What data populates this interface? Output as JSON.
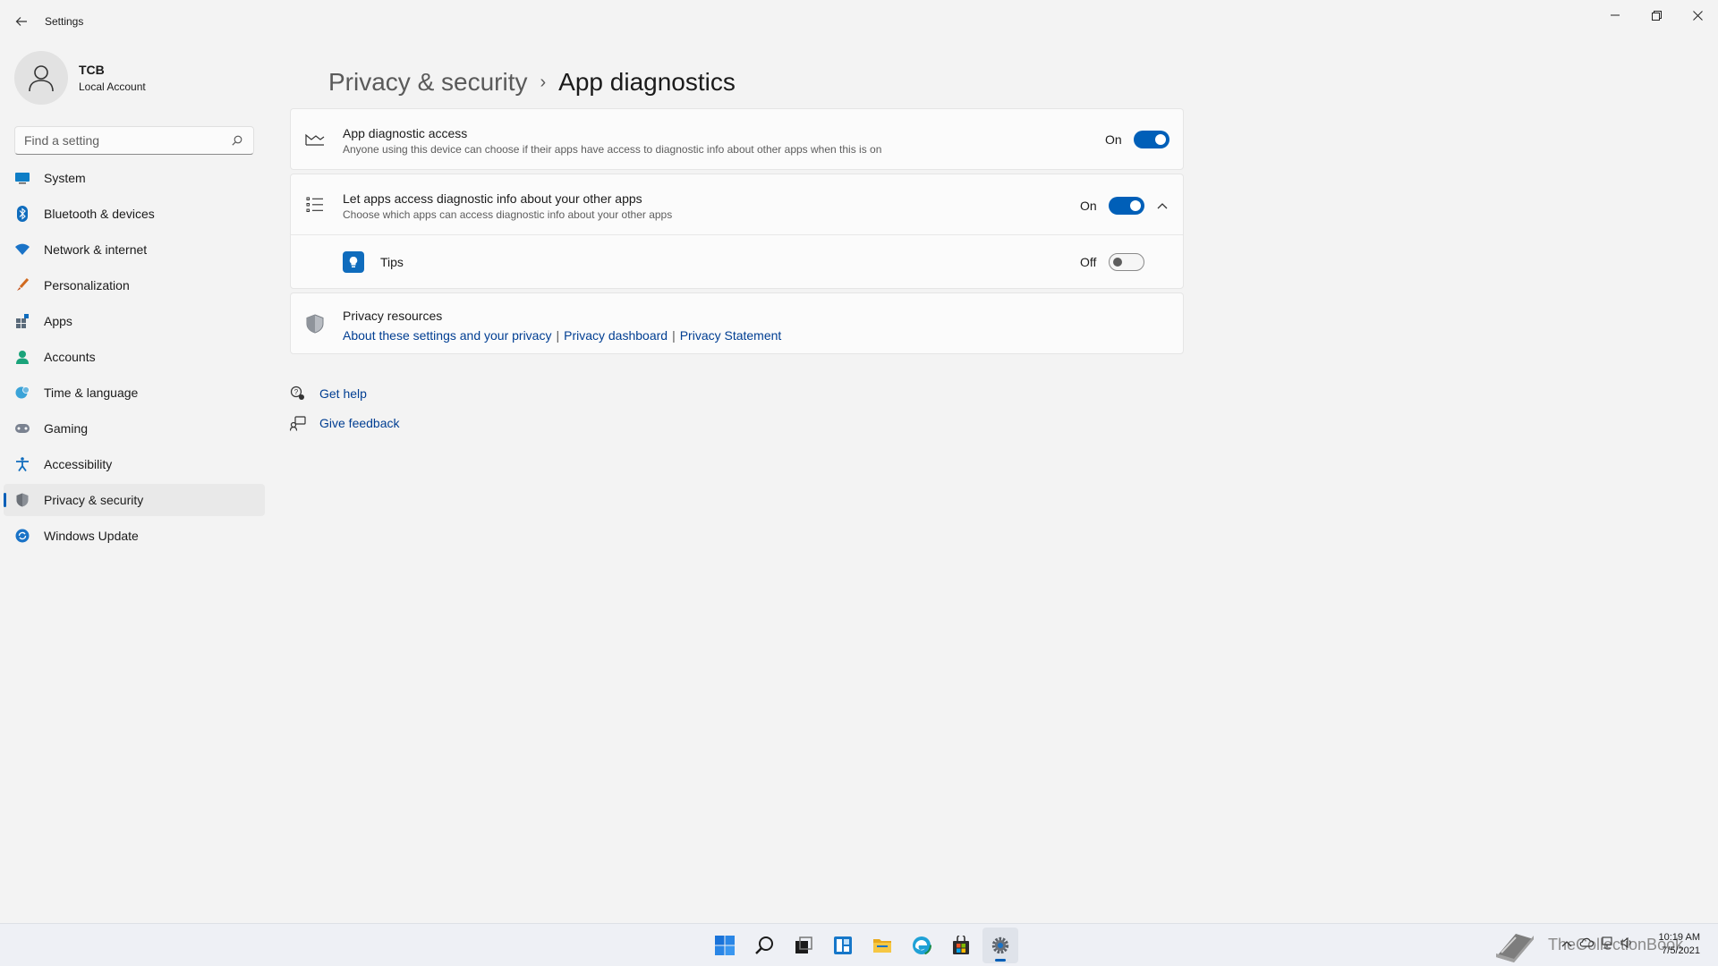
{
  "window": {
    "app_title": "Settings",
    "back_icon": "back-arrow-icon",
    "controls": [
      "minimize-icon",
      "restore-icon",
      "close-icon"
    ]
  },
  "profile": {
    "name": "TCB",
    "account_type": "Local Account"
  },
  "search": {
    "placeholder": "Find a setting"
  },
  "sidebar": {
    "items": [
      {
        "label": "System",
        "icon": "monitor-icon"
      },
      {
        "label": "Bluetooth & devices",
        "icon": "bluetooth-icon"
      },
      {
        "label": "Network & internet",
        "icon": "wifi-icon"
      },
      {
        "label": "Personalization",
        "icon": "brush-icon"
      },
      {
        "label": "Apps",
        "icon": "apps-icon"
      },
      {
        "label": "Accounts",
        "icon": "person-icon"
      },
      {
        "label": "Time & language",
        "icon": "globe-clock-icon"
      },
      {
        "label": "Gaming",
        "icon": "gamepad-icon"
      },
      {
        "label": "Accessibility",
        "icon": "accessibility-icon"
      },
      {
        "label": "Privacy & security",
        "icon": "shield-icon",
        "selected": true
      },
      {
        "label": "Windows Update",
        "icon": "update-icon"
      }
    ]
  },
  "breadcrumb": {
    "parent": "Privacy & security",
    "separator": "›",
    "current": "App diagnostics"
  },
  "settings": {
    "app_diagnostic_access": {
      "title": "App diagnostic access",
      "description": "Anyone using this device can choose if their apps have access to diagnostic info about other apps when this is on",
      "state": "On",
      "enabled": true
    },
    "let_apps_access": {
      "title": "Let apps access diagnostic info about your other apps",
      "description": "Choose which apps can access diagnostic info about your other apps",
      "state": "On",
      "enabled": true,
      "expanded": true
    },
    "apps": [
      {
        "name": "Tips",
        "state": "Off",
        "enabled": false,
        "icon": "tips-icon"
      }
    ]
  },
  "privacy_resources": {
    "title": "Privacy resources",
    "links": [
      "About these settings and your privacy",
      "Privacy dashboard",
      "Privacy Statement"
    ],
    "separator": "|"
  },
  "help": {
    "get_help": "Get help",
    "give_feedback": "Give feedback"
  },
  "taskbar": {
    "apps": [
      "start-icon",
      "search-icon",
      "task-view-icon",
      "widgets-icon",
      "file-explorer-icon",
      "edge-icon",
      "store-icon",
      "settings-icon"
    ],
    "active": "settings-icon",
    "watermark": "TheCollectionBook",
    "time": "10:19 AM",
    "date": "7/5/2021"
  },
  "colors": {
    "accent": "#005fb8",
    "link": "#003e92",
    "background": "#f3f3f3",
    "card": "#fbfbfb"
  }
}
